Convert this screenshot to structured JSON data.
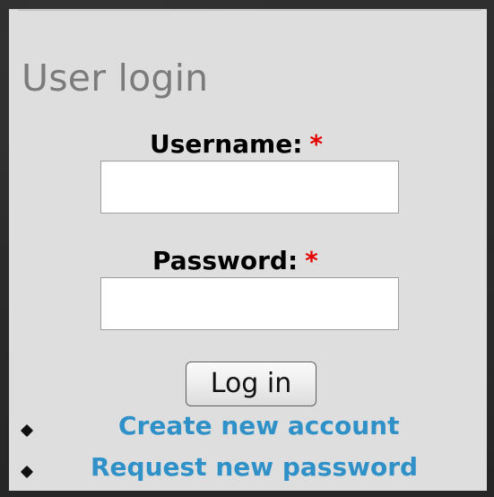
{
  "block": {
    "title": "User login"
  },
  "form": {
    "username": {
      "label": "Username:",
      "required": "*",
      "value": "",
      "placeholder": ""
    },
    "password": {
      "label": "Password:",
      "required": "*",
      "value": "",
      "placeholder": ""
    },
    "submit_label": "Log in"
  },
  "links": [
    {
      "label": "Create new account",
      "icon": "bullet-icon"
    },
    {
      "label": "Request new password",
      "icon": "bullet-icon"
    }
  ],
  "colors": {
    "background": "#2b2b2b",
    "panel": "#dedede",
    "title": "#7b7b7b",
    "required": "#e60000",
    "link": "#2f91c7"
  }
}
